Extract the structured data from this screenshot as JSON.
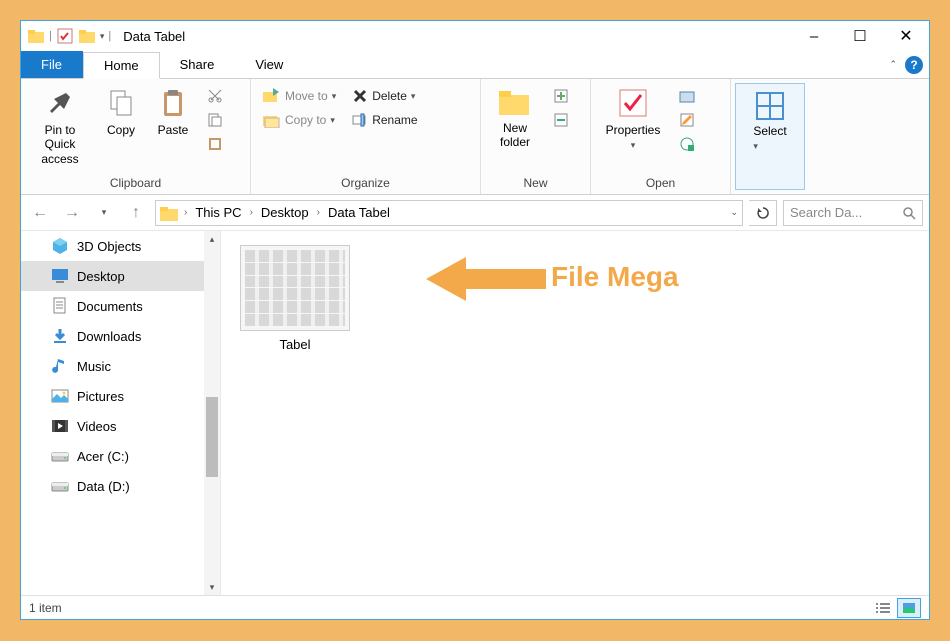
{
  "title": "Data Tabel",
  "window_controls": {
    "minimize": "–",
    "maximize": "☐",
    "close": "✕"
  },
  "menubar": {
    "file": "File",
    "home": "Home",
    "share": "Share",
    "view": "View",
    "collapse_caret": "⌃"
  },
  "ribbon": {
    "clipboard": {
      "pin": "Pin to Quick access",
      "copy": "Copy",
      "paste": "Paste",
      "label": "Clipboard"
    },
    "organize": {
      "moveto": "Move to",
      "copyto": "Copy to",
      "delete": "Delete",
      "rename": "Rename",
      "label": "Organize"
    },
    "new": {
      "newfolder": "New folder",
      "label": "New"
    },
    "open": {
      "properties": "Properties",
      "label": "Open"
    },
    "select": {
      "select": "Select"
    }
  },
  "address": {
    "thispc": "This PC",
    "desktop": "Desktop",
    "folder": "Data Tabel"
  },
  "search_placeholder": "Search Da...",
  "nav": {
    "items": [
      "3D Objects",
      "Desktop",
      "Documents",
      "Downloads",
      "Music",
      "Pictures",
      "Videos",
      "Acer (C:)",
      "Data (D:)"
    ],
    "selected_index": 1
  },
  "content": {
    "file_name": "Tabel"
  },
  "annotation_text": "File Mega",
  "status": {
    "count_text": "1 item"
  }
}
